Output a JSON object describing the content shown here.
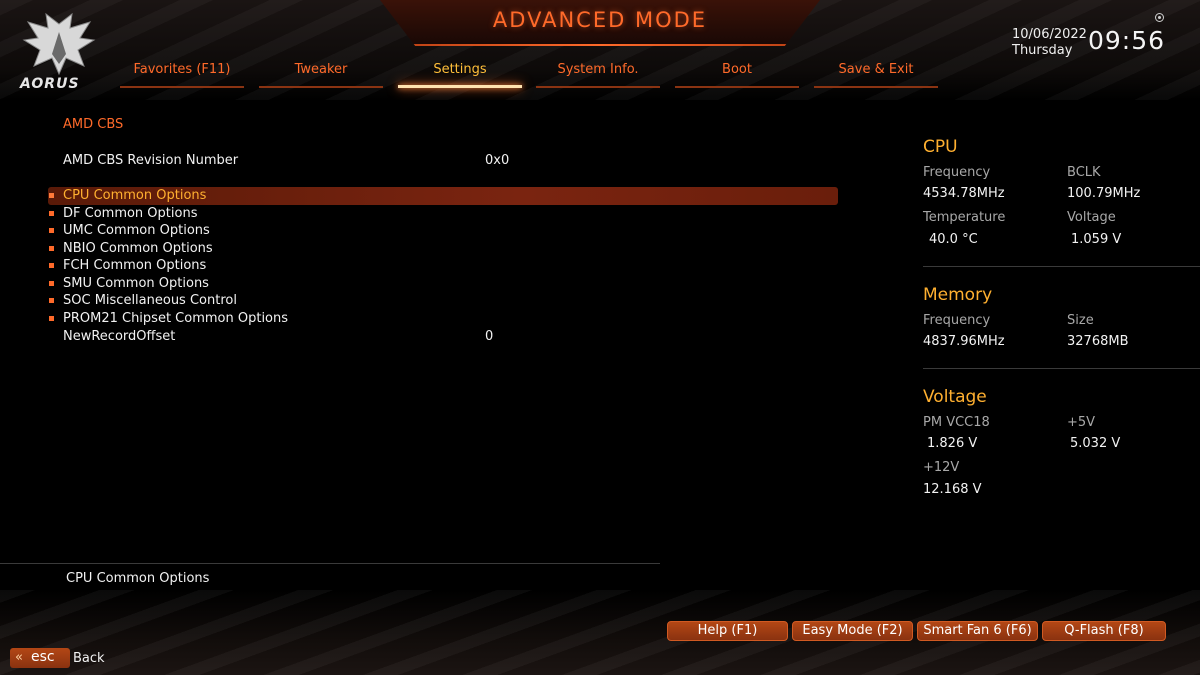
{
  "header": {
    "mode_title": "ADVANCED MODE",
    "brand": "AORUS",
    "date": "10/06/2022",
    "weekday": "Thursday",
    "time": "09:56"
  },
  "tabs": [
    {
      "label": "Favorites (F11)",
      "active": false
    },
    {
      "label": "Tweaker",
      "active": false
    },
    {
      "label": "Settings",
      "active": true
    },
    {
      "label": "System Info.",
      "active": false
    },
    {
      "label": "Boot",
      "active": false
    },
    {
      "label": "Save & Exit",
      "active": false
    }
  ],
  "main": {
    "section_title": "AMD CBS",
    "revision": {
      "label": "AMD CBS Revision Number",
      "value": "0x0"
    },
    "items": [
      {
        "label": "CPU Common Options",
        "selected": true
      },
      {
        "label": "DF Common Options"
      },
      {
        "label": "UMC Common Options"
      },
      {
        "label": "NBIO Common Options"
      },
      {
        "label": "FCH Common Options"
      },
      {
        "label": "SMU Common Options"
      },
      {
        "label": "SOC Miscellaneous Control"
      },
      {
        "label": "PROM21 Chipset Common Options"
      }
    ],
    "new_record": {
      "label": "NewRecordOffset",
      "value": "0"
    }
  },
  "help_text": "CPU Common Options",
  "info_panel": {
    "cpu": {
      "title": "CPU",
      "frequency_label": "Frequency",
      "frequency_value": "4534.78MHz",
      "bclk_label": "BCLK",
      "bclk_value": "100.79MHz",
      "temperature_label": "Temperature",
      "temperature_value": "40.0 °C",
      "voltage_label": "Voltage",
      "voltage_value": "1.059 V"
    },
    "memory": {
      "title": "Memory",
      "frequency_label": "Frequency",
      "frequency_value": "4837.96MHz",
      "size_label": "Size",
      "size_value": "32768MB"
    },
    "voltage": {
      "title": "Voltage",
      "pm_vcc18_label": "PM VCC18",
      "pm_vcc18_value": "1.826 V",
      "v5_label": "+5V",
      "v5_value": "5.032 V",
      "v12_label": "+12V",
      "v12_value": "12.168 V"
    }
  },
  "footer": {
    "buttons": [
      "Help (F1)",
      "Easy Mode (F2)",
      "Smart Fan 6 (F6)",
      "Q-Flash (F8)"
    ],
    "esc_label": "esc",
    "back_label": "Back"
  },
  "colors": {
    "accent": "#ff6a2a",
    "highlight": "#ffb030",
    "selected_row": "#7a2410",
    "button": "#a33f13"
  }
}
